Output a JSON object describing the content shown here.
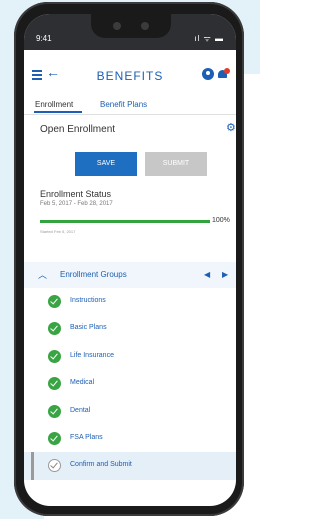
{
  "status_bar": {
    "time": "9:41",
    "icons": "ıl ᯤ ▬"
  },
  "header": {
    "title": "BENEFITS"
  },
  "tabs": [
    {
      "label": "Enrollment",
      "active": true
    },
    {
      "label": "Benefit Plans",
      "active": false
    }
  ],
  "section": {
    "title": "Open Enrollment"
  },
  "actions": {
    "save_label": "SAVE",
    "submit_label": "SUBMIT"
  },
  "enrollment_status": {
    "label": "Enrollment Status",
    "dates": "Feb 5, 2017 - Feb 28, 2017",
    "progress_percent": 100,
    "progress_text": "100%",
    "started_text": "Started Feb 5, 2017"
  },
  "groups": {
    "title": "Enrollment Groups",
    "items": [
      {
        "label": "Instructions",
        "completed": true
      },
      {
        "label": "Basic Plans",
        "completed": true
      },
      {
        "label": "Life Insurance",
        "completed": true
      },
      {
        "label": "Medical",
        "completed": true
      },
      {
        "label": "Dental",
        "completed": true
      },
      {
        "label": "FSA Plans",
        "completed": true
      },
      {
        "label": "Confirm and Submit",
        "completed": false
      }
    ]
  },
  "colors": {
    "accent": "#1d5fb3",
    "success": "#38a443",
    "notification": "#e03a2b"
  },
  "icons": [
    "hamburger-icon",
    "back-arrow-icon",
    "user-icon",
    "bell-icon",
    "gear-icon",
    "chevron-up-icon",
    "prev-icon",
    "next-icon",
    "check-icon"
  ]
}
